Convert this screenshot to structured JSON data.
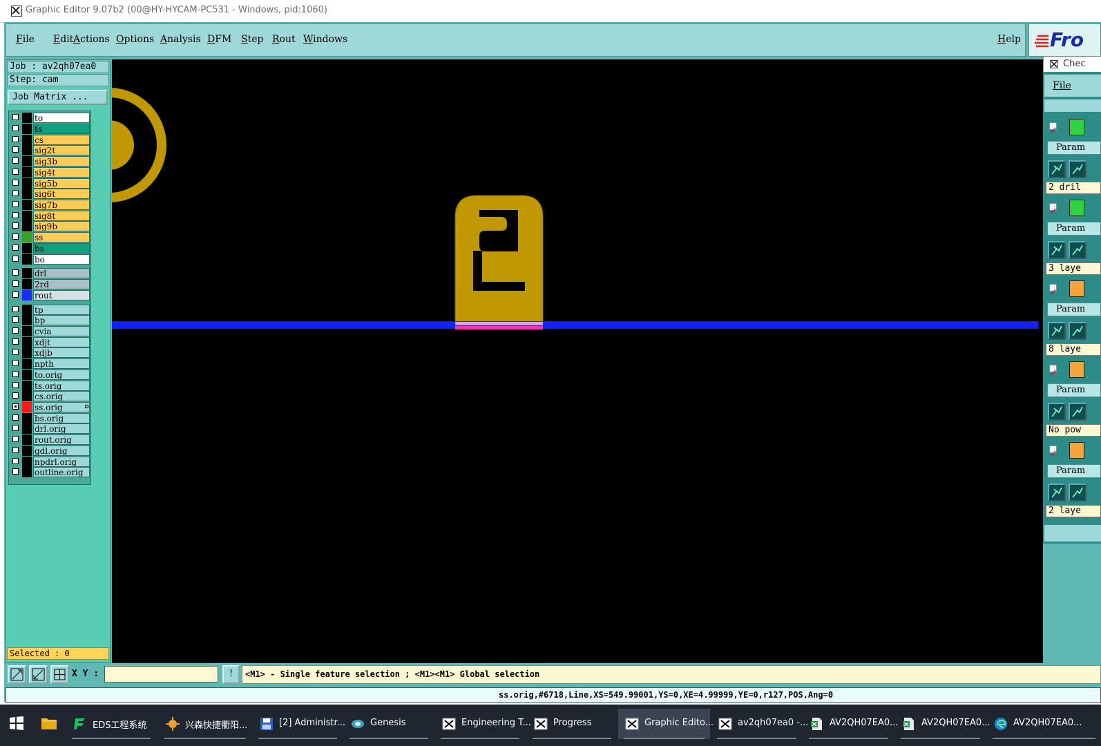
{
  "window": {
    "title": "Graphic Editor 9.07b2 (00@HY-HYCAM-PC531 - Windows, pid:1060)"
  },
  "menubar": {
    "items": [
      "File",
      "Edit",
      "Actions",
      "Options",
      "Analysis",
      "DFM",
      "Step",
      "Rout",
      "Windows"
    ],
    "help": "Help"
  },
  "logo": {
    "text": "Fro"
  },
  "left_panel": {
    "job": "Job : av2qh07ea0",
    "step": "Step: cam",
    "job_matrix": "Job Matrix ...",
    "selected": "Selected : 0"
  },
  "layers": [
    {
      "name": "to",
      "color": "#ffffff",
      "swatch": "#000000",
      "checked": false
    },
    {
      "name": "ts",
      "color": "#0fa07e",
      "swatch": "#000000",
      "checked": false
    },
    {
      "name": "cs",
      "color": "#ffcd57",
      "swatch": "#000000",
      "checked": false
    },
    {
      "name": "sig2t",
      "color": "#ffcd57",
      "swatch": "#000000",
      "checked": false
    },
    {
      "name": "sig3b",
      "color": "#ffcd57",
      "swatch": "#000000",
      "checked": false
    },
    {
      "name": "sig4t",
      "color": "#ffcd57",
      "swatch": "#000000",
      "checked": false
    },
    {
      "name": "sig5b",
      "color": "#ffcd57",
      "swatch": "#000000",
      "checked": false
    },
    {
      "name": "sig6t",
      "color": "#ffcd57",
      "swatch": "#000000",
      "checked": false
    },
    {
      "name": "sig7b",
      "color": "#ffcd57",
      "swatch": "#000000",
      "checked": false
    },
    {
      "name": "sig8t",
      "color": "#ffcd57",
      "swatch": "#000000",
      "checked": false
    },
    {
      "name": "sig9b",
      "color": "#ffcd57",
      "swatch": "#000000",
      "checked": false
    },
    {
      "name": "ss",
      "color": "#ffcd57",
      "swatch": "#38a02a",
      "checked": false
    },
    {
      "name": "bs",
      "color": "#0fa07e",
      "swatch": "#000000",
      "checked": false
    },
    {
      "name": "bo",
      "color": "#ffffff",
      "swatch": "#000000",
      "checked": false
    },
    {
      "name": "drl",
      "color": "#a8bfc6",
      "swatch": "#000000",
      "checked": false
    },
    {
      "name": "2rd",
      "color": "#a8bfc6",
      "swatch": "#000000",
      "checked": false
    },
    {
      "name": "rout",
      "color": "#d6dfe2",
      "swatch": "#1b2cff",
      "checked": false
    },
    {
      "name": "tp",
      "color": "#9fd8d8",
      "swatch": "#000000",
      "checked": false
    },
    {
      "name": "bp",
      "color": "#9fd8d8",
      "swatch": "#000000",
      "checked": false
    },
    {
      "name": "cvia",
      "color": "#9fd8d8",
      "swatch": "#000000",
      "checked": false
    },
    {
      "name": "xdjt",
      "color": "#9fd8d8",
      "swatch": "#000000",
      "checked": false
    },
    {
      "name": "xdjb",
      "color": "#9fd8d8",
      "swatch": "#000000",
      "checked": false
    },
    {
      "name": "npth",
      "color": "#9fd8d8",
      "swatch": "#000000",
      "checked": false
    },
    {
      "name": "to.orig",
      "color": "#9fd8d8",
      "swatch": "#000000",
      "checked": false
    },
    {
      "name": "ts.orig",
      "color": "#9fd8d8",
      "swatch": "#000000",
      "checked": false
    },
    {
      "name": "cs.orig",
      "color": "#9fd8d8",
      "swatch": "#000000",
      "checked": false
    },
    {
      "name": "ss.orig",
      "color": "#9fd8d8",
      "swatch": "#ff1a1a",
      "checked": true,
      "marked": true
    },
    {
      "name": "bs.orig",
      "color": "#9fd8d8",
      "swatch": "#000000",
      "checked": false
    },
    {
      "name": "drl.orig",
      "color": "#9fd8d8",
      "swatch": "#000000",
      "checked": false
    },
    {
      "name": "rout.orig",
      "color": "#9fd8d8",
      "swatch": "#000000",
      "checked": false
    },
    {
      "name": "gdl.orig",
      "color": "#9fd8d8",
      "swatch": "#000000",
      "checked": false
    },
    {
      "name": "npdrl.orig",
      "color": "#9fd8d8",
      "swatch": "#000000",
      "checked": false
    },
    {
      "name": "outline.orig",
      "color": "#9fd8d8",
      "swatch": "#000000",
      "checked": false
    }
  ],
  "canvas": {
    "pad_color": "#c29800",
    "rout_color": "#1421ff",
    "highlight_color": "#ff2fb4",
    "pad_text": "2"
  },
  "right_panel": {
    "title": "Chec",
    "menu": "File",
    "params_label": "Param",
    "results": [
      "2 dril",
      "3 laye",
      "8 laye",
      "No pow",
      "2 laye"
    ]
  },
  "command": {
    "xy_label": "X Y :",
    "xy_value": "",
    "bang": "!",
    "hint": "<M1> - Single feature selection ; <M1><M1> Global selection"
  },
  "status": {
    "text": "ss.orig,#6718,Line,XS=549.99001,YS=0,XE=4.99999,YE=0,r127,POS,Ang=0"
  },
  "taskbar": {
    "items": [
      {
        "label": "EDS工程系统",
        "icon": "eds-icon"
      },
      {
        "label": "兴森快捷衢阳...",
        "icon": "sun-icon"
      },
      {
        "label": "[2] Administr...",
        "icon": "floppy-icon"
      },
      {
        "label": "Genesis",
        "icon": "genesis-icon"
      },
      {
        "label": "Engineering T...",
        "icon": "x-window-icon"
      },
      {
        "label": "Progress",
        "icon": "x-window-icon"
      },
      {
        "label": "Graphic Edito...",
        "icon": "x-window-icon",
        "active": true
      },
      {
        "label": "av2qh07ea0 -...",
        "icon": "x-window-icon"
      },
      {
        "label": "AV2QH07EA0...",
        "icon": "document-icon"
      },
      {
        "label": "AV2QH07EA0...",
        "icon": "document-icon"
      },
      {
        "label": "AV2QH07EA0...",
        "icon": "edge-icon"
      }
    ]
  }
}
